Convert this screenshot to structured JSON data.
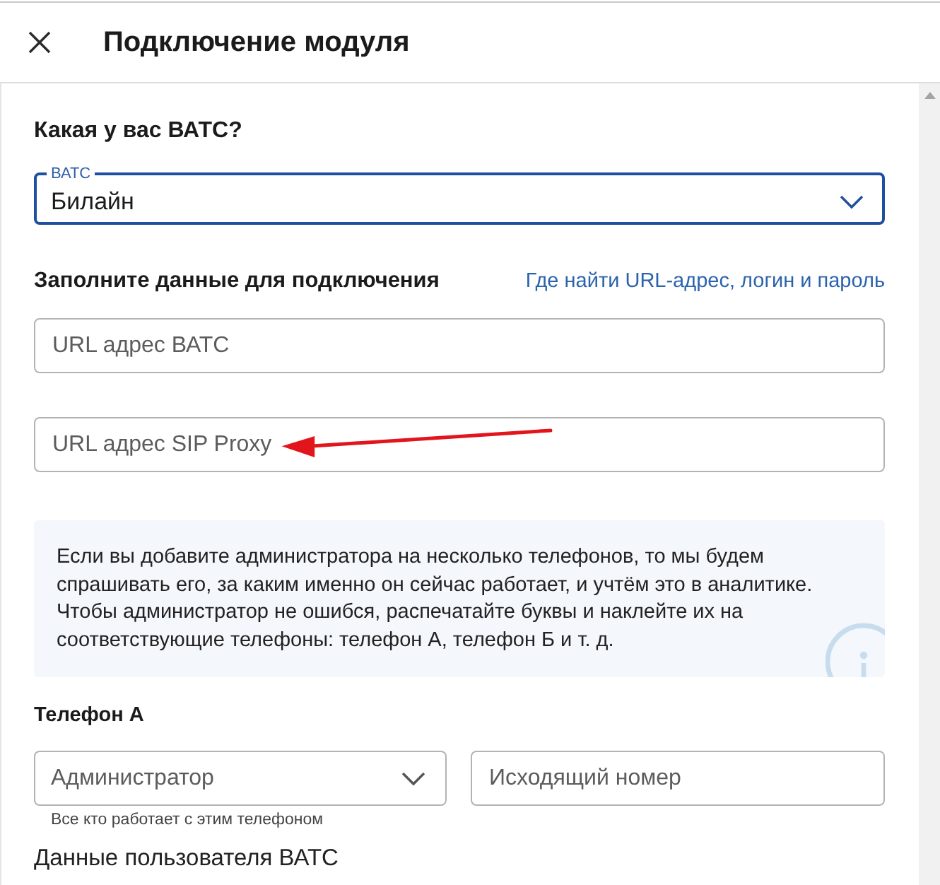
{
  "header": {
    "title": "Подключение модуля"
  },
  "pbx": {
    "heading": "Какая у вас ВАТС?",
    "select": {
      "label": "ВАТС",
      "value": "Билайн",
      "focused": true
    }
  },
  "connection": {
    "heading": "Заполните данные для подключения",
    "help_link": "Где найти URL-адрес, логин и пароль",
    "fields": [
      {
        "placeholder": "URL адрес ВАТС",
        "annotated": false
      },
      {
        "placeholder": "URL адрес SIP Proxy",
        "annotated": true
      }
    ]
  },
  "info": {
    "text": "Если вы добавите администратора на несколько телефонов, то мы будем спрашивать его, за каким именно он сейчас работает, и учтём это в аналитике. Чтобы администратор не ошибся, распечатайте буквы и наклейте их на соответствующие телефоны: телефон А, телефон Б и т. д."
  },
  "phone": {
    "heading": "Телефон А",
    "role_select": {
      "placeholder": "Администратор",
      "helper": "Все кто работает с этим телефоном",
      "focused": false
    },
    "number_field": {
      "placeholder": "Исходящий номер"
    }
  },
  "user_section": {
    "heading": "Данные пользователя ВАТС"
  }
}
